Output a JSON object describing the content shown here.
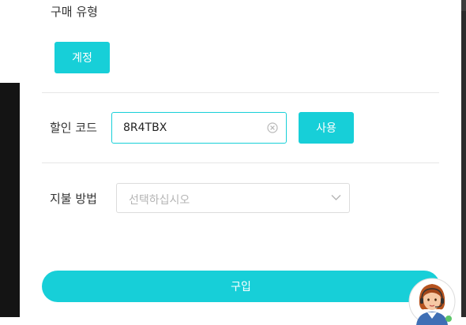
{
  "purchase_type": {
    "label": "구매 유형",
    "account_button": "계정"
  },
  "discount": {
    "label": "할인 코드",
    "code_value": "8R4TBX",
    "apply_button": "사용"
  },
  "payment": {
    "label": "지불 방법",
    "placeholder": "선택하십시오"
  },
  "buy_button": "구입",
  "colors": {
    "accent": "#17cfd8",
    "divider": "#e6e6e6",
    "placeholder": "#b5b5b5"
  },
  "icons": {
    "clear": "clear-circle-icon",
    "chevron": "chevron-down-icon",
    "support": "support-agent-avatar"
  }
}
